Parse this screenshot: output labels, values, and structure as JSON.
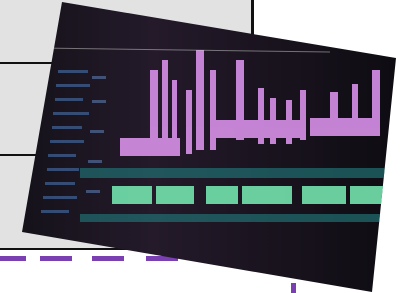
{
  "image": {
    "subject": "video-editing-timeline-photo",
    "colors": {
      "background_panel": "#e2e2e2",
      "frame_lines": "#111111",
      "dash_accent": "#7a3fb0",
      "photo_dark": "#1a1620",
      "clip_pink": "#d890e8",
      "clip_green": "#6fd9a6",
      "timeline_teal": "#1f6a6d"
    }
  }
}
